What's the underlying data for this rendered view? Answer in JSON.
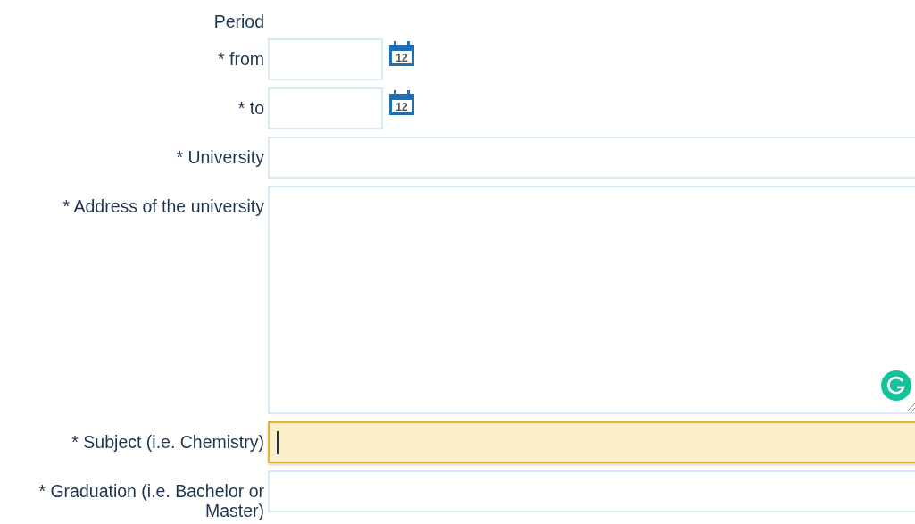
{
  "rows": [
    {
      "kind": "heading",
      "label": "Period"
    },
    {
      "kind": "date",
      "label": "* from",
      "calendar_day": "12",
      "focused": false
    },
    {
      "kind": "date",
      "label": "* to",
      "calendar_day": "12",
      "focused": false
    },
    {
      "kind": "text",
      "label": "* University",
      "focused": false
    },
    {
      "kind": "textarea",
      "label": "* Address of the university",
      "focused": false
    },
    {
      "kind": "text",
      "label": "* Subject (i.e. Chemistry)",
      "focused": true
    },
    {
      "kind": "text",
      "label": "* Graduation (i.e. Bachelor or Master)",
      "focused": false
    }
  ]
}
